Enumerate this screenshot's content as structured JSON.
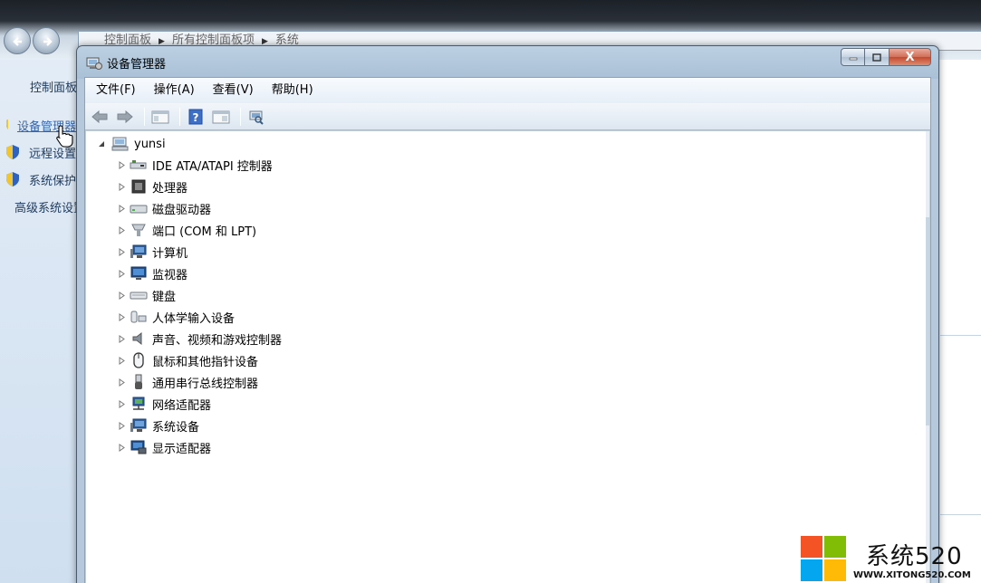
{
  "background_window": {
    "breadcrumb": [
      "控制面板",
      "所有控制面板项",
      "系统"
    ],
    "sidebar_heading": "控制面板主页",
    "sidebar_links": [
      {
        "label": "设备管理器",
        "icon": "shield-icon",
        "active": true
      },
      {
        "label": "远程设置",
        "icon": "shield-icon",
        "active": false
      },
      {
        "label": "系统保护",
        "icon": "shield-icon",
        "active": false
      },
      {
        "label": "高级系统设置",
        "icon": "shield-icon",
        "active": false
      }
    ]
  },
  "device_manager": {
    "title": "设备管理器",
    "caption_buttons": {
      "close_glyph": "X"
    },
    "menu": [
      "文件(F)",
      "操作(A)",
      "查看(V)",
      "帮助(H)"
    ],
    "toolbar": [
      "back-arrow-icon",
      "forward-arrow-icon",
      "properties-view-icon",
      "help-icon",
      "list-view-icon",
      "scan-hardware-icon"
    ],
    "tree": {
      "root": {
        "label": "yunsi",
        "icon": "computer-icon",
        "expanded": true
      },
      "children": [
        {
          "label": "IDE ATA/ATAPI 控制器",
          "icon": "ide-controller-icon"
        },
        {
          "label": "处理器",
          "icon": "processor-icon"
        },
        {
          "label": "磁盘驱动器",
          "icon": "disk-drive-icon"
        },
        {
          "label": "端口 (COM 和 LPT)",
          "icon": "port-icon"
        },
        {
          "label": "计算机",
          "icon": "computer-icon"
        },
        {
          "label": "监视器",
          "icon": "monitor-icon"
        },
        {
          "label": "键盘",
          "icon": "keyboard-icon"
        },
        {
          "label": "人体学输入设备",
          "icon": "hid-icon"
        },
        {
          "label": "声音、视频和游戏控制器",
          "icon": "speaker-icon"
        },
        {
          "label": "鼠标和其他指针设备",
          "icon": "mouse-icon"
        },
        {
          "label": "通用串行总线控制器",
          "icon": "usb-icon"
        },
        {
          "label": "网络适配器",
          "icon": "network-adapter-icon"
        },
        {
          "label": "系统设备",
          "icon": "system-device-icon"
        },
        {
          "label": "显示适配器",
          "icon": "display-adapter-icon"
        }
      ]
    }
  },
  "watermark": {
    "text": "系统520",
    "url": "WWW.XITONG520.COM",
    "colors": [
      "#f35325",
      "#81bc06",
      "#05a6f0",
      "#ffba08"
    ]
  }
}
